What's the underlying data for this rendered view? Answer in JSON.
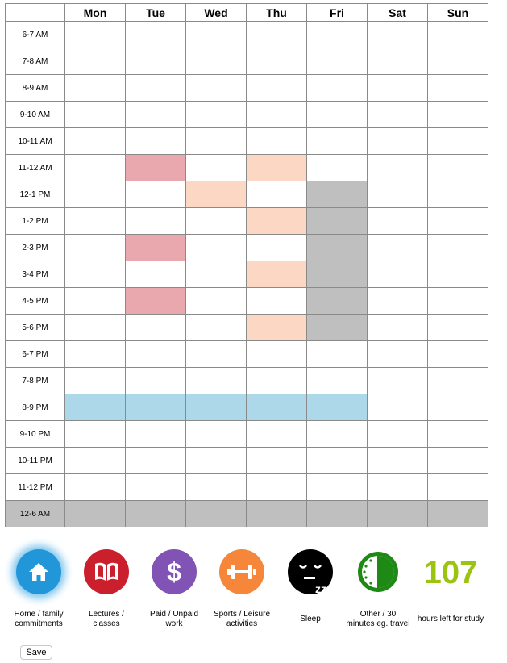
{
  "schedule": {
    "days": [
      "Mon",
      "Tue",
      "Wed",
      "Thu",
      "Fri",
      "Sat",
      "Sun"
    ],
    "times": [
      "6-7 AM",
      "7-8 AM",
      "8-9 AM",
      "9-10 AM",
      "10-11 AM",
      "11-12 AM",
      "12-1 PM",
      "1-2 PM",
      "2-3 PM",
      "3-4 PM",
      "4-5 PM",
      "5-6 PM",
      "6-7 PM",
      "7-8 PM",
      "8-9 PM",
      "9-10 PM",
      "10-11 PM",
      "11-12 PM",
      "12-6 AM"
    ],
    "category_colors": {
      "lectures": "#e9a7ae",
      "sports": "#fcd7c3",
      "sleep": "#bfbfbf",
      "home": "#add8ea"
    },
    "filled": {
      "11-12 AM": {
        "Tue": "lectures",
        "Thu": "sports"
      },
      "12-1 PM": {
        "Wed": "sports",
        "Fri": "sleep"
      },
      "1-2 PM": {
        "Thu": "sports",
        "Fri": "sleep"
      },
      "2-3 PM": {
        "Tue": "lectures",
        "Fri": "sleep"
      },
      "3-4 PM": {
        "Thu": "sports",
        "Fri": "sleep"
      },
      "4-5 PM": {
        "Tue": "lectures",
        "Fri": "sleep"
      },
      "5-6 PM": {
        "Thu": "sports",
        "Fri": "sleep"
      },
      "8-9 PM": {
        "Mon": "home",
        "Tue": "home",
        "Wed": "home",
        "Thu": "home",
        "Fri": "home"
      },
      "12-6 AM": {
        "Mon": "sleep",
        "Tue": "sleep",
        "Wed": "sleep",
        "Thu": "sleep",
        "Fri": "sleep",
        "Sat": "sleep",
        "Sun": "sleep",
        "__row": "sleep"
      }
    }
  },
  "legend": {
    "items": [
      {
        "key": "home",
        "icon": "home-icon",
        "label_line1": "Home / family",
        "label_line2": "commitments",
        "color": "#2196d8",
        "selected": true
      },
      {
        "key": "lectures",
        "icon": "book-icon",
        "label_line1": "Lectures /",
        "label_line2": "classes",
        "color": "#cc1f2d",
        "selected": false
      },
      {
        "key": "paid",
        "icon": "dollar-icon",
        "label_line1": "Paid / Unpaid",
        "label_line2": "work",
        "color": "#8153b5",
        "selected": false
      },
      {
        "key": "sports",
        "icon": "dumbbell-icon",
        "label_line1": "Sports / Leisure",
        "label_line2": "activities",
        "color": "#f6863a",
        "selected": false
      },
      {
        "key": "sleep",
        "icon": "sleeping-face-icon",
        "label_line1": "Sleep",
        "label_line2": "",
        "color": "#000000",
        "selected": false
      },
      {
        "key": "other",
        "icon": "half-clock-icon",
        "label_line1": "Other / 30",
        "label_line2": "minutes eg. travel",
        "color": "#1e8a15",
        "selected": false
      }
    ],
    "hours_left": {
      "value": "107",
      "label": "hours left for study",
      "color": "#9bc411"
    }
  },
  "save_label": "Save"
}
